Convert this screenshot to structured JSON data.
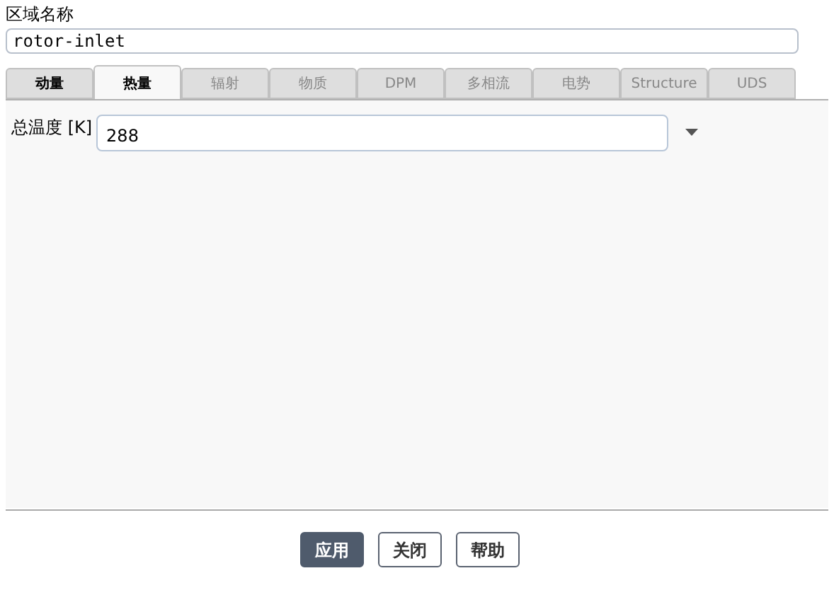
{
  "zone_name": {
    "label": "区域名称",
    "value": "rotor-inlet"
  },
  "tabs": [
    {
      "label": "动量",
      "selected": false,
      "disabled": false
    },
    {
      "label": "热量",
      "selected": true,
      "disabled": false
    },
    {
      "label": "辐射",
      "selected": false,
      "disabled": true
    },
    {
      "label": "物质",
      "selected": false,
      "disabled": true
    },
    {
      "label": "DPM",
      "selected": false,
      "disabled": true
    },
    {
      "label": "多相流",
      "selected": false,
      "disabled": true
    },
    {
      "label": "电势",
      "selected": false,
      "disabled": true
    },
    {
      "label": "Structure",
      "selected": false,
      "disabled": true
    },
    {
      "label": "UDS",
      "selected": false,
      "disabled": true
    }
  ],
  "total_temperature": {
    "label": "总温度 [K]",
    "value": "288"
  },
  "buttons": [
    {
      "label": "应用",
      "kind": "primary"
    },
    {
      "label": "关闭",
      "kind": "secondary"
    },
    {
      "label": "帮助",
      "kind": "secondary"
    }
  ]
}
